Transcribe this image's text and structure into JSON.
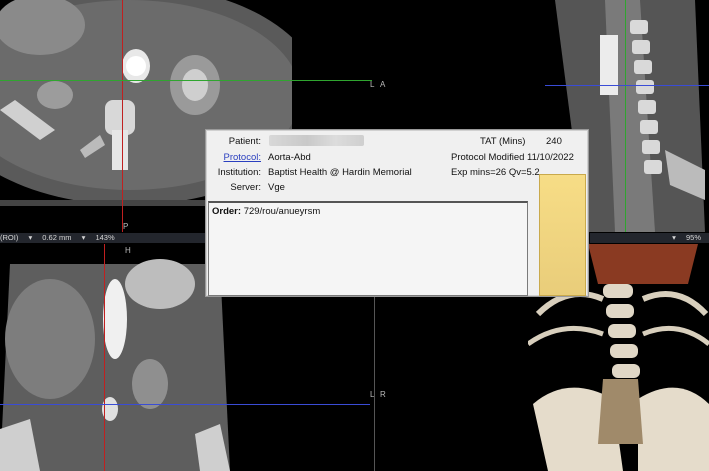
{
  "viewports": {
    "axial": {
      "orientation_right": "A",
      "orientation_bottom": "P",
      "orientation_right2": "L"
    },
    "sagittal": {
      "orientation_left": "A"
    },
    "coronal": {
      "orientation_top": "H",
      "orientation_right": "R"
    },
    "axial_status": {
      "roi": "(ROI)",
      "thickness": "0.62 mm",
      "zoom": "143%"
    },
    "vr_status": {
      "zoom": "95%"
    }
  },
  "dialog": {
    "patient_label": "Patient:",
    "protocol_label": "Protocol:",
    "protocol_value": "Aorta-Abd",
    "institution_label": "Institution:",
    "institution_value": "Baptist Health @ Hardin Memorial",
    "server_label": "Server:",
    "server_value": "Vge",
    "tat_label": "TAT (Mins)",
    "tat_value": "240",
    "protocol_modified": "Protocol Modified 11/10/2022",
    "exp_info": "Exp mins=26 Qv=5.2",
    "order_label": "Order:",
    "order_value": "729/rou/anueyrsm"
  },
  "colors": {
    "crosshair_green": "#2fa52f",
    "crosshair_blue": "#3a4cd6",
    "crosshair_red": "#c02020",
    "note_yellow": "#f2d886"
  }
}
